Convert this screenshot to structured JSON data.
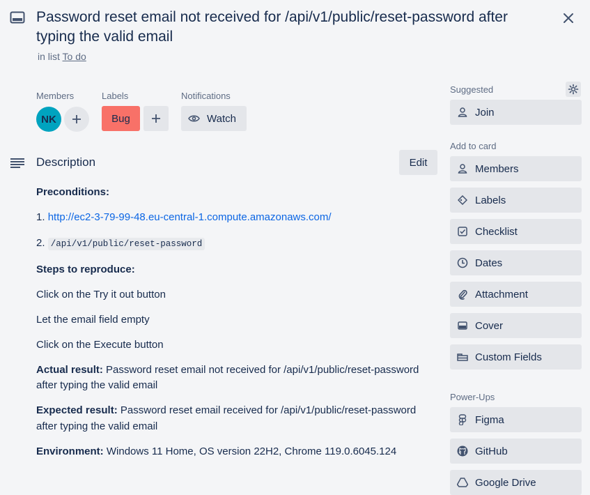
{
  "card": {
    "title": "Password reset email not received for /api/v1/public/reset-password after typing the valid email",
    "in_list_prefix": "in list",
    "list_name": "To do"
  },
  "members": {
    "label": "Members",
    "avatar_initials": "NK"
  },
  "labels": {
    "label": "Labels",
    "items": [
      {
        "name": "Bug",
        "color": "#f87168"
      }
    ]
  },
  "notifications": {
    "label": "Notifications",
    "watch_label": "Watch"
  },
  "description": {
    "heading": "Description",
    "edit_label": "Edit",
    "preconditions_heading": "Preconditions:",
    "item1_num": "1.",
    "item1_link": "http://ec2-3-79-99-48.eu-central-1.compute.amazonaws.com/",
    "item2_num": "2.",
    "item2_code": "/api/v1/public/reset-password",
    "steps_heading": "Steps to reproduce:",
    "steps": [
      "Click on the Try it out button",
      "Let the email field empty",
      "Click on the Execute button"
    ],
    "actual_label": "Actual result:",
    "actual_text_1": " Password reset email not received for /api/v1/public/reset-password",
    "actual_text_2": "after typing the valid email",
    "expected_label": "Expected result:",
    "expected_text_1": " Password reset email received for /api/v1/public/reset-password",
    "expected_text_2": "after typing the valid email",
    "environment_label": "Environment:",
    "environment_text": " Windows 11 Home, OS version 22H2, Chrome 119.0.6045.124"
  },
  "sidebar": {
    "suggested_label": "Suggested",
    "join_label": "Join",
    "add_to_card_label": "Add to card",
    "add_to_card": [
      {
        "label": "Members",
        "icon": "person-icon"
      },
      {
        "label": "Labels",
        "icon": "tag-icon"
      },
      {
        "label": "Checklist",
        "icon": "checklist-icon"
      },
      {
        "label": "Dates",
        "icon": "clock-icon"
      },
      {
        "label": "Attachment",
        "icon": "paperclip-icon"
      },
      {
        "label": "Cover",
        "icon": "cover-icon"
      },
      {
        "label": "Custom Fields",
        "icon": "custom-fields-icon"
      }
    ],
    "power_ups_label": "Power-Ups",
    "power_ups": [
      {
        "label": "Figma",
        "icon": "figma-icon"
      },
      {
        "label": "GitHub",
        "icon": "github-icon"
      },
      {
        "label": "Google Drive",
        "icon": "google-drive-icon"
      }
    ]
  }
}
